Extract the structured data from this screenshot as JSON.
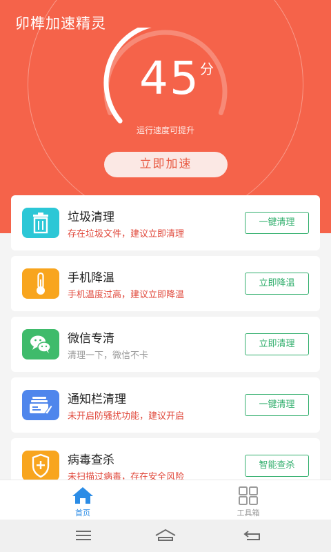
{
  "colors": {
    "hero": "#f5634a",
    "action": "#2fae6b",
    "warn_text": "#e0473a",
    "muted_text": "#999999",
    "tab_active": "#2b8ce6",
    "tab_inactive": "#9a9a9a"
  },
  "header": {
    "title": "卯榫加速精灵"
  },
  "gauge": {
    "score": "45",
    "unit": "分",
    "level_fraction": 0.45,
    "hint": "运行速度可提升"
  },
  "boost_button": {
    "label": "立即加速"
  },
  "cards": [
    {
      "icon": "trash-icon",
      "icon_color": "#2cc7d6",
      "title": "垃圾清理",
      "subtitle": "存在垃圾文件，建议立即清理",
      "subtitle_color": "#e0473a",
      "action": "一键清理"
    },
    {
      "icon": "thermometer-icon",
      "icon_color": "#f8a51e",
      "title": "手机降温",
      "subtitle": "手机温度过高，建议立即降温",
      "subtitle_color": "#e0473a",
      "action": "立即降温"
    },
    {
      "icon": "wechat-icon",
      "icon_color": "#3fbb6b",
      "title": "微信专清",
      "subtitle": "清理一下，微信不卡",
      "subtitle_color": "#999999",
      "action": "立即清理"
    },
    {
      "icon": "notification-broom-icon",
      "icon_color": "#4f86ec",
      "title": "通知栏清理",
      "subtitle": "未开启防骚扰功能，建议开启",
      "subtitle_color": "#e0473a",
      "action": "一键清理"
    },
    {
      "icon": "shield-plus-icon",
      "icon_color": "#f8a51e",
      "title": "病毒查杀",
      "subtitle": "未扫描过病毒，存在安全风险",
      "subtitle_color": "#e0473a",
      "action": "智能查杀"
    }
  ],
  "tabbar": {
    "home_label": "首页",
    "tools_label": "工具箱"
  }
}
